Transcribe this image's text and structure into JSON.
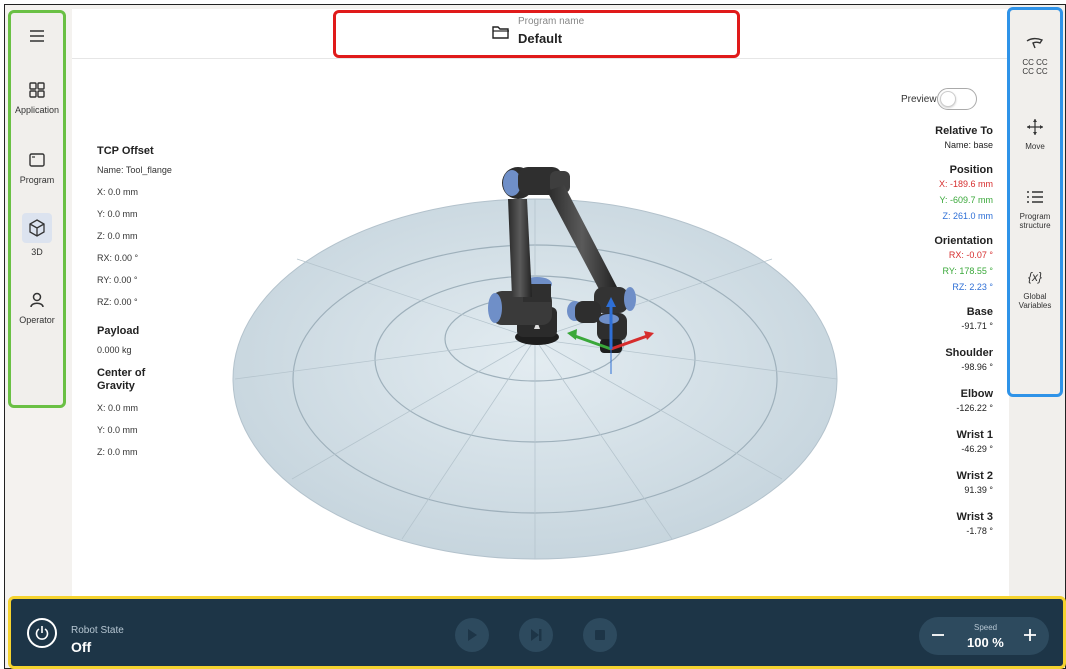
{
  "program": {
    "caption": "Program name",
    "name": "Default"
  },
  "left_nav": [
    {
      "label": "",
      "icon": "menu-icon"
    },
    {
      "label": "Application",
      "icon": "grid-icon"
    },
    {
      "label": "Program",
      "icon": "window-icon"
    },
    {
      "label": "3D",
      "icon": "cube-icon",
      "active": true
    },
    {
      "label": "Operator",
      "icon": "person-icon"
    }
  ],
  "right_nav": [
    {
      "label": "CC CC\nCC CC",
      "icon": "hand-icon"
    },
    {
      "label": "Move",
      "icon": "move-icon"
    },
    {
      "label": "Program\nstructure",
      "icon": "list-icon"
    },
    {
      "label": "Global\nVariables",
      "icon": "variables-icon",
      "glyph": "{x}"
    }
  ],
  "preview": {
    "label": "Preview",
    "on": false
  },
  "tcp": {
    "heading": "TCP Offset",
    "name": "Name: Tool_flange",
    "x": "X: 0.0 mm",
    "y": "Y: 0.0 mm",
    "z": "Z: 0.0 mm",
    "rx": "RX: 0.00 °",
    "ry": "RY: 0.00 °",
    "rz": "RZ: 0.00 °"
  },
  "payload": {
    "heading": "Payload",
    "value": "0.000 kg"
  },
  "cog": {
    "heading_line1": "Center of",
    "heading_line2": "Gravity",
    "x": "X: 0.0 mm",
    "y": "Y: 0.0 mm",
    "z": "Z: 0.0 mm"
  },
  "relative_to": {
    "heading": "Relative To",
    "name": "Name: base"
  },
  "position": {
    "heading": "Position",
    "x": "X: -189.6 mm",
    "y": "Y: -609.7 mm",
    "z": "Z: 261.0 mm"
  },
  "orientation": {
    "heading": "Orientation",
    "rx": "RX: -0.07 °",
    "ry": "RY: 178.55 °",
    "rz": "RZ: 2.23 °"
  },
  "joints": [
    {
      "name": "Base",
      "value": "-91.71 °"
    },
    {
      "name": "Shoulder",
      "value": "-98.96 °"
    },
    {
      "name": "Elbow",
      "value": "-126.22 °"
    },
    {
      "name": "Wrist 1",
      "value": "-46.29 °"
    },
    {
      "name": "Wrist 2",
      "value": "91.39 °"
    },
    {
      "name": "Wrist 3",
      "value": "-1.78 °"
    }
  ],
  "robot_state": {
    "label": "Robot State",
    "value": "Off"
  },
  "speed": {
    "label": "Speed",
    "value": "100 %"
  },
  "colors": {
    "x_axis": "#d62d2d",
    "y_axis": "#3aa83a",
    "z_axis": "#2e6fd6"
  }
}
